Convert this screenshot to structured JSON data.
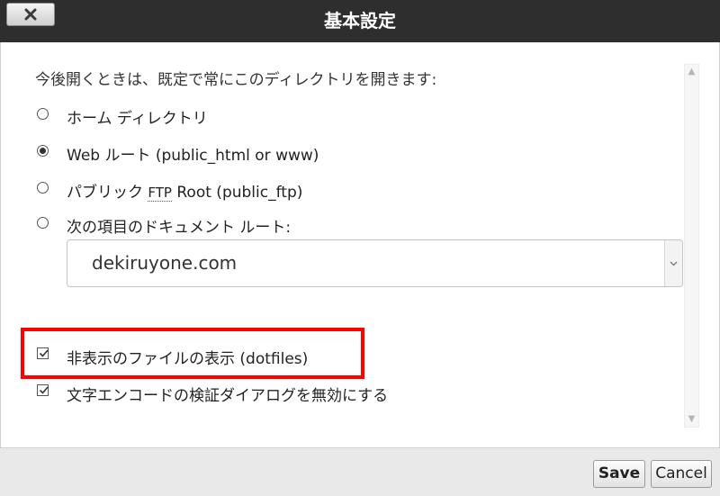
{
  "dialog": {
    "title": "基本設定",
    "close_icon": "close-x-icon"
  },
  "content": {
    "intro": "今後開くときは、既定で常にこのディレクトリを開きます:",
    "options": [
      {
        "label": "ホーム ディレクトリ",
        "checked": false
      },
      {
        "label_prefix": "Web ルート (public_html or www)",
        "checked": true
      },
      {
        "label_prefix": "パブリック ",
        "abbr": "FTP",
        "label_suffix": " Root (public_ftp)",
        "checked": false
      },
      {
        "label": "次の項目のドキュメント ルート:",
        "checked": false
      }
    ],
    "document_root_select": {
      "value": "dekiruyone.com",
      "arrow_icon": "chevron-down-icon"
    },
    "checkboxes": [
      {
        "label": "非表示のファイルの表示 (dotfiles)",
        "checked": true
      },
      {
        "label": "文字エンコードの検証ダイアログを無効にする",
        "checked": true
      }
    ],
    "highlight_color": "#ff0000"
  },
  "footer": {
    "save_label": "Save",
    "cancel_label": "Cancel"
  }
}
